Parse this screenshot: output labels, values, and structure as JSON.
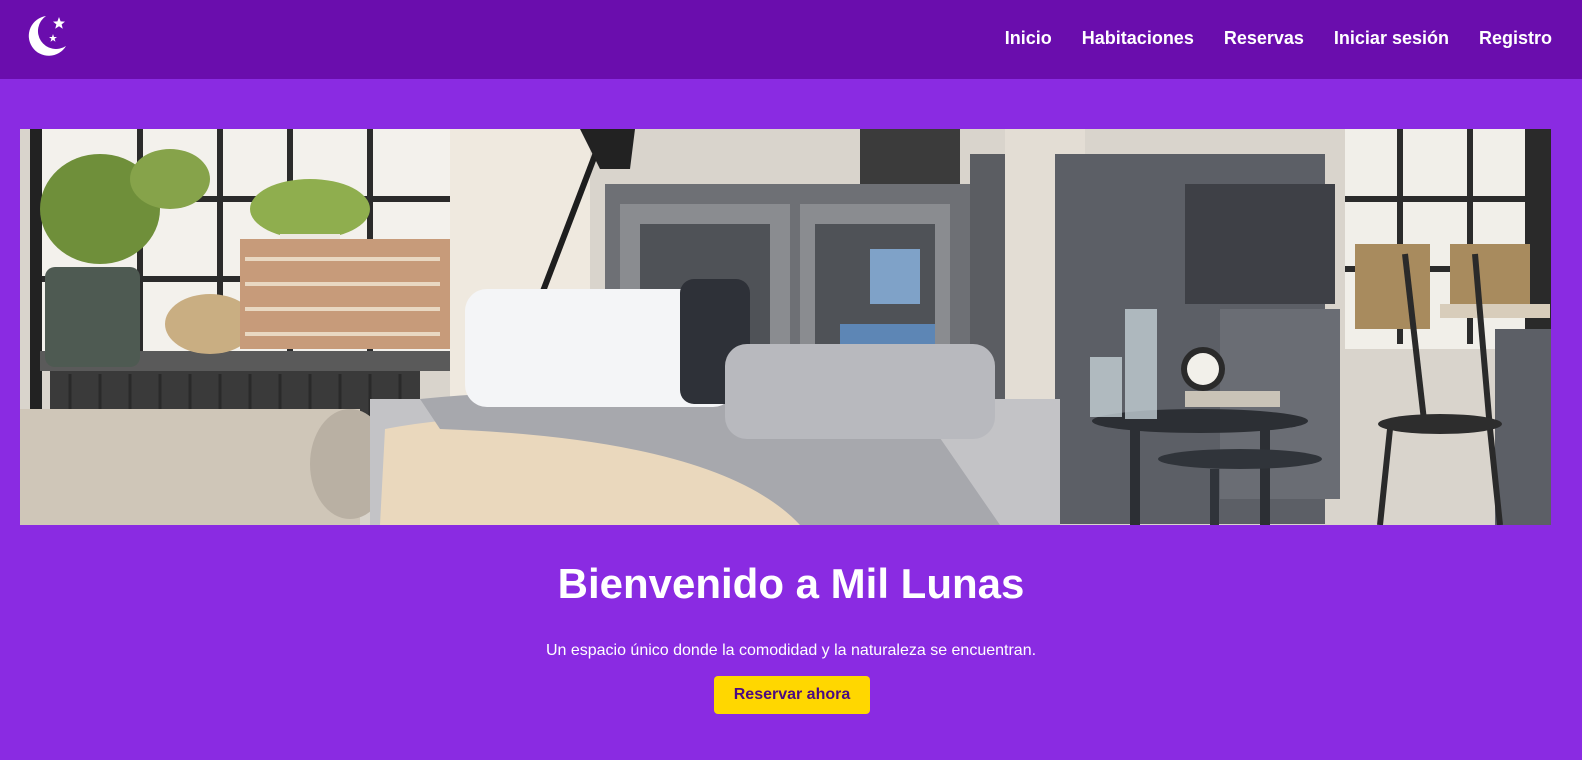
{
  "nav": {
    "logo_icon": "moon-stars-icon",
    "links": [
      {
        "label": "Inicio"
      },
      {
        "label": "Habitaciones"
      },
      {
        "label": "Reservas"
      },
      {
        "label": "Iniciar sesión"
      },
      {
        "label": "Registro"
      }
    ]
  },
  "hero": {
    "title": "Bienvenido a Mil Lunas",
    "subtitle": "Un espacio único donde la comodidad y la naturaleza se encuentran.",
    "cta_label": "Reservar ahora"
  },
  "colors": {
    "page_background": "#8a2be2",
    "navbar_background": "#6a0dad",
    "cta_background": "#ffd700",
    "cta_text": "#4b0a82"
  }
}
